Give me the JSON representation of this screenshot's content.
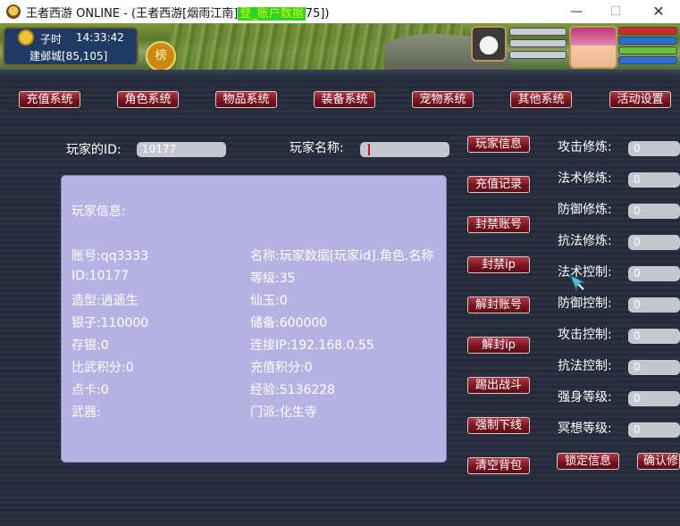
{
  "window": {
    "title_prefix": "王者西游 ONLINE -  (王者西游[烟雨江南]",
    "title_highlight": "登_账户数据",
    "title_suffix": "75])",
    "min_glyph": "—",
    "max_glyph": "☐",
    "close_glyph": "✕"
  },
  "hud": {
    "time_period": "子时",
    "clock": "14:33:42",
    "location": "建邺城[85,105]",
    "rank_badge": "榜"
  },
  "menu": [
    {
      "label": "充值系统"
    },
    {
      "label": "角色系统"
    },
    {
      "label": "物品系统"
    },
    {
      "label": "装备系统"
    },
    {
      "label": "宠物系统"
    },
    {
      "label": "其他系统"
    },
    {
      "label": "活动设置"
    }
  ],
  "form": {
    "player_id_label": "玩家的ID:",
    "player_id_value": "10177",
    "player_name_label": "玩家名称:",
    "player_name_value": ""
  },
  "info": {
    "heading": "玩家信息:",
    "left": [
      "账号:qq3333",
      "ID:10177",
      "造型:逍遥生",
      "银子:110000",
      "存银:0",
      "比武积分:0",
      "点卡:0",
      "武器:"
    ],
    "right": [
      "名称:玩家数据[玩家id].角色.名称",
      "等级:35",
      "仙玉:0",
      "储备:600000",
      "连接IP:192.168.0.55",
      "充值积分:0",
      "经验:5136228",
      "门派:化生寺"
    ]
  },
  "actions": [
    {
      "label": "玩家信息"
    },
    {
      "label": "充值记录"
    },
    {
      "label": "封禁账号"
    },
    {
      "label": "封禁ip"
    },
    {
      "label": "解封账号"
    },
    {
      "label": "解封ip"
    },
    {
      "label": "踢出战斗"
    },
    {
      "label": "强制下线"
    },
    {
      "label": "清空背包"
    }
  ],
  "stats": [
    {
      "label": "攻击修炼:",
      "value": "0"
    },
    {
      "label": "法术修炼:",
      "value": "0"
    },
    {
      "label": "防御修炼:",
      "value": "0"
    },
    {
      "label": "抗法修炼:",
      "value": "0"
    },
    {
      "label": "法术控制:",
      "value": "0"
    },
    {
      "label": "防御控制:",
      "value": "0"
    },
    {
      "label": "攻击控制:",
      "value": "0"
    },
    {
      "label": "抗法控制:",
      "value": "0"
    },
    {
      "label": "强身等级:",
      "value": "0"
    },
    {
      "label": "冥想等级:",
      "value": "0"
    }
  ],
  "footer_buttons": {
    "lock": "锁定信息",
    "confirm": "确认修"
  },
  "colors": {
    "button": "#7a1420",
    "info_box": "#b7b2e4",
    "field": "#c6c6cf",
    "title_highlight": "#2bd62b"
  }
}
